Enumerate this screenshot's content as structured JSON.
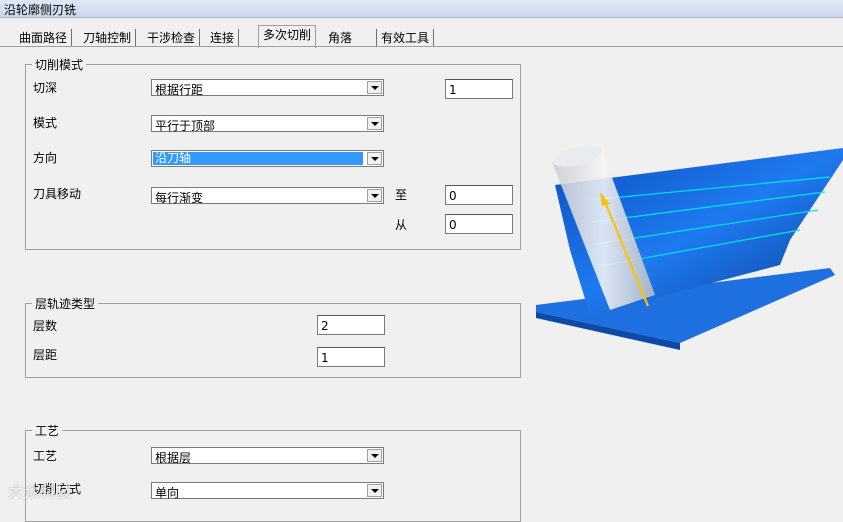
{
  "window": {
    "title": "沿轮廓侧刃铣"
  },
  "tabs": [
    "曲面路径",
    "刀轴控制",
    "干涉检查",
    "连接",
    "多次切削",
    "角落",
    "有效工具"
  ],
  "active_tab": "多次切削",
  "cut_mode": {
    "legend": "切削模式",
    "depth_label": "切深",
    "depth_value": "根据行距",
    "depth_input": "1",
    "mode_label": "模式",
    "mode_value": "平行于顶部",
    "direction_label": "方向",
    "direction_value": "沿刀轴",
    "tool_move_label": "刀具移动",
    "tool_move_value": "每行渐变",
    "to_label": "至",
    "to_value": "0",
    "from_label": "从",
    "from_value": "0"
  },
  "layer_path": {
    "legend": "层轨迹类型",
    "count_label": "层数",
    "count_value": "2",
    "spacing_label": "层距",
    "spacing_value": "1"
  },
  "process": {
    "legend": "工艺",
    "process_label": "工艺",
    "process_value": "根据层",
    "cut_style_label": "切削方式",
    "cut_style_value": "单向"
  },
  "watermark": "大众科技",
  "colors": {
    "accent": "#3399ff",
    "part_blue": "#1e6fe0",
    "tool_path": "#00e5ff",
    "arrow": "#ffc107"
  }
}
